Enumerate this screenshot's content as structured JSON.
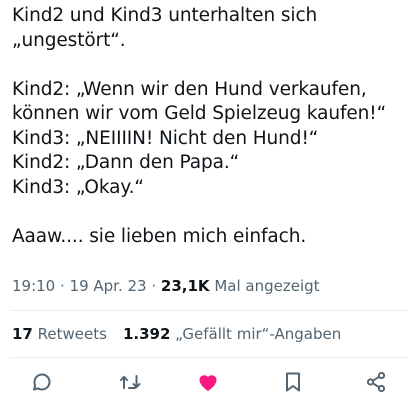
{
  "tweet": {
    "lines": [
      "Kind2 und Kind3 unterhalten sich",
      "„ungestört“.",
      "",
      "Kind2: „Wenn wir den Hund verkaufen,",
      "können wir vom Geld Spielzeug kaufen!“",
      "Kind3: „NEIIIIN! Nicht den Hund!“",
      "Kind2: „Dann den Papa.“",
      "Kind3: „Okay.“",
      "",
      "Aaaw.... sie lieben mich einfach."
    ]
  },
  "meta": {
    "time": "19:10",
    "separator1": " · ",
    "date": "19 Apr. 23",
    "separator2": " · ",
    "views_count": "23,1K",
    "views_label": " Mal angezeigt"
  },
  "stats": {
    "retweets_count": "17",
    "retweets_label": " Retweets",
    "likes_count": "1.392",
    "likes_label": " „Gefällt mir“-Angaben"
  },
  "actions": {
    "reply_icon": "speech-bubble-icon",
    "retweet_icon": "retweet-arrows-icon",
    "like_icon": "heart-filled-icon",
    "bookmark_icon": "bookmark-icon",
    "share_icon": "share-nodes-icon",
    "like_color": "#f91880",
    "icon_color": "#536471"
  }
}
